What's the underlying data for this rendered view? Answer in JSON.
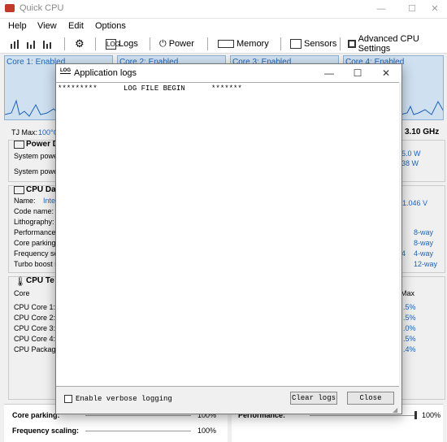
{
  "window": {
    "title": "Quick CPU"
  },
  "menu": [
    "Help",
    "View",
    "Edit",
    "Options"
  ],
  "toolbar": {
    "logs": "Logs",
    "power": "Power",
    "memory": "Memory",
    "sensors": "Sensors",
    "advanced": "Advanced CPU Settings",
    "logs_icon_text": "LOG"
  },
  "cores": [
    "Core 1: Enabled",
    "Core 2: Enabled",
    "Core 3: Enabled",
    "Core 4: Enabled"
  ],
  "tj": {
    "label": "TJ Max:",
    "value": "100°C",
    "freq": "3.10 GHz"
  },
  "power": {
    "title": "Power D",
    "rows": [
      {
        "label": "System power",
        "value": "5.0 W"
      },
      {
        "label": "System power",
        "value": "38 W"
      }
    ]
  },
  "cpu_data": {
    "title": "CPU Da",
    "name_label": "Name:",
    "name_value": "Inte",
    "voltage": "1.046 V",
    "rows": [
      {
        "label": "Code name:",
        "value": ""
      },
      {
        "label": "Lithography:",
        "value": ""
      },
      {
        "label": "Performance c",
        "value": "8-way"
      },
      {
        "label": "Core parking i",
        "value": "8-way"
      },
      {
        "label": "Frequency sc",
        "value": "4",
        "value2": "4-way"
      },
      {
        "label": "Turbo boost in",
        "value": "12-way"
      }
    ]
  },
  "cpu_temp": {
    "title": "CPU Te",
    "header": "Core",
    "max_header": "Max",
    "rows": [
      {
        "label": "CPU Core 1:",
        "max": ".5%"
      },
      {
        "label": "CPU Core 2:",
        "max": ".5%"
      },
      {
        "label": "CPU Core 3:",
        "max": ".0%"
      },
      {
        "label": "CPU Core 4:",
        "max": ".5%"
      },
      {
        "label": "CPU Package",
        "max": ".4%"
      }
    ]
  },
  "bottom": {
    "core_parking_label": "Core parking:",
    "core_parking_value": "100%",
    "freq_scaling_label": "Frequency scaling:",
    "freq_scaling_value": "100%",
    "performance_label": "Performance:",
    "performance_value": "100%"
  },
  "dialog": {
    "title": "Application logs",
    "icon_text": "LOG",
    "log_text": "*********      LOG FILE BEGIN      *******",
    "verbose_label": "Enable verbose logging",
    "clear_label": "Clear logs",
    "close_label": "Close",
    "window_controls": {
      "minimize": "—",
      "maximize": "☐",
      "close": "✕"
    }
  },
  "main_window_controls": {
    "minimize": "—",
    "maximize": "☐",
    "close": "✕"
  },
  "colors": {
    "accent": "#1d63b8",
    "graph_bg": "#cfe0f0"
  }
}
